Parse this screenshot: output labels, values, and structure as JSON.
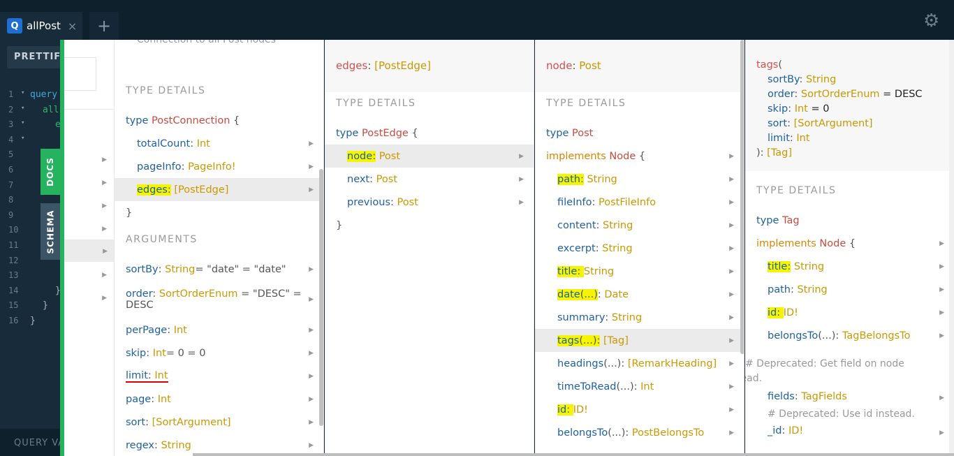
{
  "tab": {
    "icon": "Q",
    "title": "allPost",
    "close": "×",
    "new": "+"
  },
  "toolbar": {
    "prettify": "PRETTIFY",
    "settings_icon": "gear-icon"
  },
  "editor": {
    "lines": [
      "1",
      "2",
      "3",
      "4",
      "5",
      "6",
      "7",
      "8",
      "9",
      "10",
      "11",
      "12",
      "13",
      "14",
      "15",
      "16"
    ],
    "code": [
      "query",
      "all",
      "e",
      "",
      "",
      "",
      "",
      "",
      "",
      "",
      "",
      "",
      "",
      "}",
      "}",
      "}"
    ],
    "query_vars": "QUERY VA"
  },
  "sidebar": {
    "docs": "DOCS",
    "schema": "SCHEMA"
  },
  "p1": {
    "desc": "Connection to all Post nodes",
    "type_details": "TYPE DETAILS",
    "type_kw": "type",
    "type_name": "PostConnection",
    "brace_open": "{",
    "brace_close": "}",
    "fields": [
      {
        "name": "totalCount",
        "type": "Int"
      },
      {
        "name": "pageInfo",
        "type": "PageInfo!"
      },
      {
        "name": "edges",
        "type": "[PostEdge]"
      }
    ],
    "arguments": "ARGUMENTS",
    "args": [
      {
        "name": "sortBy",
        "type": "String",
        "def": " = \"date\" = \"date\""
      },
      {
        "name": "order",
        "type": "SortOrderEnum",
        "def": " = \"DESC\" =",
        "def2": "DESC"
      },
      {
        "name": "perPage",
        "type": "Int",
        "def": ""
      },
      {
        "name": "skip",
        "type": "Int",
        "def": " = 0 = 0"
      },
      {
        "name": "limit",
        "type": "Int",
        "def": ""
      },
      {
        "name": "page",
        "type": "Int",
        "def": ""
      },
      {
        "name": "sort",
        "type": "[SortArgument]",
        "def": ""
      },
      {
        "name": "regex",
        "type": "String",
        "def": ""
      }
    ]
  },
  "p2": {
    "header_name": "edges",
    "header_type": "[PostEdge]",
    "type_details": "TYPE DETAILS",
    "type_kw": "type",
    "type_name": "PostEdge",
    "brace_open": "{",
    "brace_close": "}",
    "fields": [
      {
        "name": "node",
        "type": "Post"
      },
      {
        "name": "next",
        "type": "Post"
      },
      {
        "name": "previous",
        "type": "Post"
      }
    ]
  },
  "p3": {
    "header_name": "node",
    "header_type": "Post",
    "type_details": "TYPE DETAILS",
    "type_kw": "type",
    "type_name": "Post",
    "implements_kw": "implements",
    "iface": "Node",
    "brace_open": "{",
    "fields": [
      {
        "name": "path",
        "args": "",
        "type": "String"
      },
      {
        "name": "fileInfo",
        "args": "",
        "type": "PostFileInfo"
      },
      {
        "name": "content",
        "args": "",
        "type": "String"
      },
      {
        "name": "excerpt",
        "args": "",
        "type": "String"
      },
      {
        "name": "title",
        "args": "",
        "type": "String"
      },
      {
        "name": "date",
        "args": "(...)",
        "type": "Date"
      },
      {
        "name": "summary",
        "args": "",
        "type": "String"
      },
      {
        "name": "tags",
        "args": "(...)",
        "type": "[Tag]"
      },
      {
        "name": "headings",
        "args": "(...)",
        "type": "[RemarkHeading]"
      },
      {
        "name": "timeToRead",
        "args": "(...)",
        "type": "Int"
      },
      {
        "name": "id",
        "args": "",
        "type": "ID!"
      },
      {
        "name": "belongsTo",
        "args": "(...)",
        "type": "PostBelongsTo"
      }
    ]
  },
  "p4": {
    "sig_name": "tags",
    "sig_open": "(",
    "sig_args": [
      {
        "name": "sortBy",
        "type": "String",
        "def": ""
      },
      {
        "name": "order",
        "type": "SortOrderEnum",
        "def": " = DESC"
      },
      {
        "name": "skip",
        "type": "Int",
        "def": " = 0"
      },
      {
        "name": "sort",
        "type": "[SortArgument]",
        "def": ""
      },
      {
        "name": "limit",
        "type": "Int",
        "def": ""
      }
    ],
    "sig_close": "): ",
    "sig_type": "[Tag]",
    "type_details": "TYPE DETAILS",
    "type_kw": "type",
    "type_name": "Tag",
    "implements_kw": "implements",
    "iface": "Node",
    "brace_open": "{",
    "fields": [
      {
        "name": "title",
        "args": "",
        "type": "String"
      },
      {
        "name": "path",
        "args": "",
        "type": "String"
      },
      {
        "name": "id",
        "args": "",
        "type": "ID!"
      },
      {
        "name": "belongsTo",
        "args": "(...)",
        "type": "TagBelongsTo"
      }
    ],
    "deprecated1": "# Deprecated: Get field on node instead.",
    "fields_field": {
      "name": "fields",
      "type": "TagFields"
    },
    "deprecated2": "# Deprecated: Use id instead.",
    "id_field": {
      "name": "_id",
      "type": "ID!"
    }
  }
}
